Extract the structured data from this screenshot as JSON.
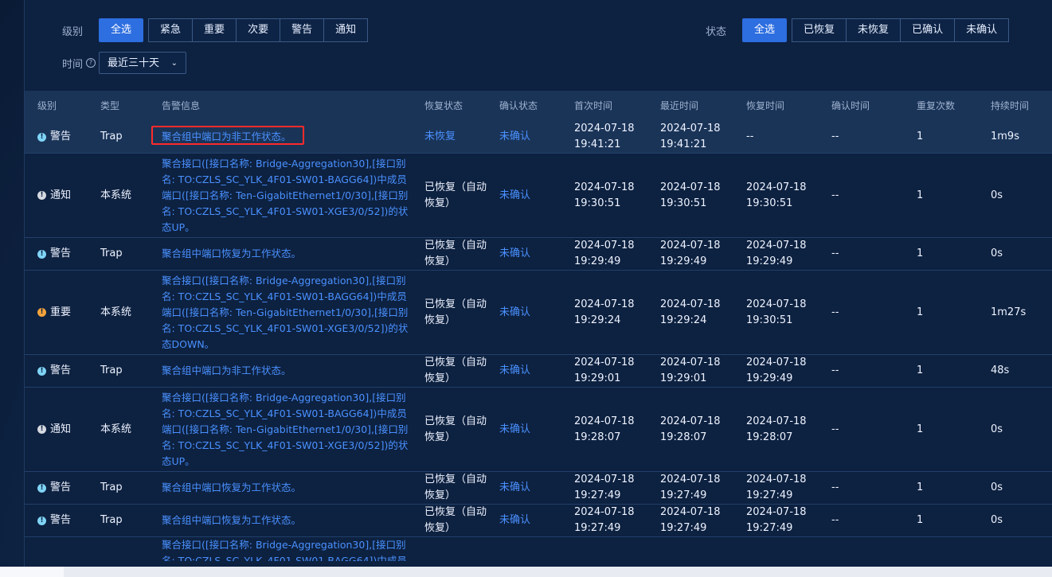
{
  "filters": {
    "level": {
      "label": "级别",
      "options": [
        "全选",
        "紧急",
        "重要",
        "次要",
        "警告",
        "通知"
      ]
    },
    "status": {
      "label": "状态",
      "options": [
        "全选",
        "已恢复",
        "未恢复",
        "已确认",
        "未确认"
      ]
    },
    "time": {
      "label": "时间",
      "help_icon": "?",
      "value": "最近三十天"
    }
  },
  "table": {
    "columns": [
      "级别",
      "类型",
      "告警信息",
      "恢复状态",
      "确认状态",
      "首次时间",
      "最近时间",
      "恢复时间",
      "确认时间",
      "重复次数",
      "持续时间"
    ],
    "rows": [
      {
        "level": "警告",
        "level_kind": "warn",
        "type": "Trap",
        "msg": "聚合组中端口为非工作状态。",
        "recover": "未恢复",
        "recover_link": true,
        "confirm": "未确认",
        "first": "2024-07-18 19:41:21",
        "last": "2024-07-18 19:41:21",
        "recover_time": "--",
        "confirm_time": "--",
        "repeat": "1",
        "duration": "1m9s"
      },
      {
        "level": "通知",
        "level_kind": "notice",
        "type": "本系统",
        "msg": "聚合接口([接口名称: Bridge-Aggregation30],[接口别名: TO:CZLS_SC_YLK_4F01-SW01-BAGG64])中成员端口([接口名称: Ten-GigabitEthernet1/0/30],[接口别名: TO:CZLS_SC_YLK_4F01-SW01-XGE3/0/52])的状态UP。",
        "recover": "已恢复（自动恢复）",
        "recover_link": false,
        "confirm": "未确认",
        "first": "2024-07-18 19:30:51",
        "last": "2024-07-18 19:30:51",
        "recover_time": "2024-07-18 19:30:51",
        "confirm_time": "--",
        "repeat": "1",
        "duration": "0s"
      },
      {
        "level": "警告",
        "level_kind": "warn",
        "type": "Trap",
        "msg": "聚合组中端口恢复为工作状态。",
        "recover": "已恢复（自动恢复）",
        "recover_link": false,
        "confirm": "未确认",
        "first": "2024-07-18 19:29:49",
        "last": "2024-07-18 19:29:49",
        "recover_time": "2024-07-18 19:29:49",
        "confirm_time": "--",
        "repeat": "1",
        "duration": "0s"
      },
      {
        "level": "重要",
        "level_kind": "major",
        "type": "本系统",
        "msg": "聚合接口([接口名称: Bridge-Aggregation30],[接口别名: TO:CZLS_SC_YLK_4F01-SW01-BAGG64])中成员端口([接口名称: Ten-GigabitEthernet1/0/30],[接口别名: TO:CZLS_SC_YLK_4F01-SW01-XGE3/0/52])的状态DOWN。",
        "recover": "已恢复（自动恢复）",
        "recover_link": false,
        "confirm": "未确认",
        "first": "2024-07-18 19:29:24",
        "last": "2024-07-18 19:29:24",
        "recover_time": "2024-07-18 19:30:51",
        "confirm_time": "--",
        "repeat": "1",
        "duration": "1m27s"
      },
      {
        "level": "警告",
        "level_kind": "warn",
        "type": "Trap",
        "msg": "聚合组中端口为非工作状态。",
        "recover": "已恢复（自动恢复）",
        "recover_link": false,
        "confirm": "未确认",
        "first": "2024-07-18 19:29:01",
        "last": "2024-07-18 19:29:01",
        "recover_time": "2024-07-18 19:29:49",
        "confirm_time": "--",
        "repeat": "1",
        "duration": "48s"
      },
      {
        "level": "通知",
        "level_kind": "notice",
        "type": "本系统",
        "msg": "聚合接口([接口名称: Bridge-Aggregation30],[接口别名: TO:CZLS_SC_YLK_4F01-SW01-BAGG64])中成员端口([接口名称: Ten-GigabitEthernet1/0/30],[接口别名: TO:CZLS_SC_YLK_4F01-SW01-XGE3/0/52])的状态UP。",
        "recover": "已恢复（自动恢复）",
        "recover_link": false,
        "confirm": "未确认",
        "first": "2024-07-18 19:28:07",
        "last": "2024-07-18 19:28:07",
        "recover_time": "2024-07-18 19:28:07",
        "confirm_time": "--",
        "repeat": "1",
        "duration": "0s"
      },
      {
        "level": "警告",
        "level_kind": "warn",
        "type": "Trap",
        "msg": "聚合组中端口恢复为工作状态。",
        "recover": "已恢复（自动恢复）",
        "recover_link": false,
        "confirm": "未确认",
        "first": "2024-07-18 19:27:49",
        "last": "2024-07-18 19:27:49",
        "recover_time": "2024-07-18 19:27:49",
        "confirm_time": "--",
        "repeat": "1",
        "duration": "0s"
      },
      {
        "level": "警告",
        "level_kind": "warn",
        "type": "Trap",
        "msg": "聚合组中端口恢复为工作状态。",
        "recover": "已恢复（自动恢复）",
        "recover_link": false,
        "confirm": "未确认",
        "first": "2024-07-18 19:27:49",
        "last": "2024-07-18 19:27:49",
        "recover_time": "2024-07-18 19:27:49",
        "confirm_time": "--",
        "repeat": "1",
        "duration": "0s"
      },
      {
        "level": "",
        "level_kind": "",
        "type": "",
        "msg": "聚合接口([接口名称: Bridge-Aggregation30],[接口别名: TO:CZLS_SC_YLK_4F01-SW01-BAGG64])中成员",
        "recover": "",
        "recover_link": false,
        "confirm": "",
        "first": "",
        "last": "",
        "recover_time": "",
        "confirm_time": "",
        "repeat": "",
        "duration": ""
      }
    ]
  },
  "colors": {
    "accent": "#2d6ee0",
    "link": "#4a91ff",
    "highlight_box": "#ff2a2a"
  }
}
